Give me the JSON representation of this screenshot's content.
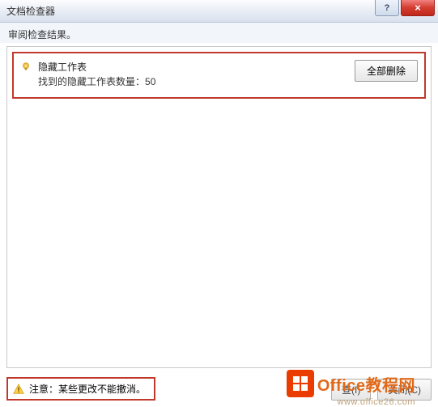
{
  "window": {
    "title": "文档检查器",
    "help_symbol": "?",
    "close_symbol": "×"
  },
  "subheader": "审阅检查结果。",
  "result": {
    "title": "隐藏工作表",
    "detail_prefix": "找到的隐藏工作表数量：",
    "count": "50",
    "delete_all_label": "全部删除"
  },
  "warning": {
    "label": "注意：",
    "text": "某些更改不能撤消。"
  },
  "footer_buttons": {
    "inspect": "查(I)",
    "close": "关闭(C)"
  },
  "watermark": {
    "brand": "Office教程网",
    "url": "www.office26.com"
  }
}
